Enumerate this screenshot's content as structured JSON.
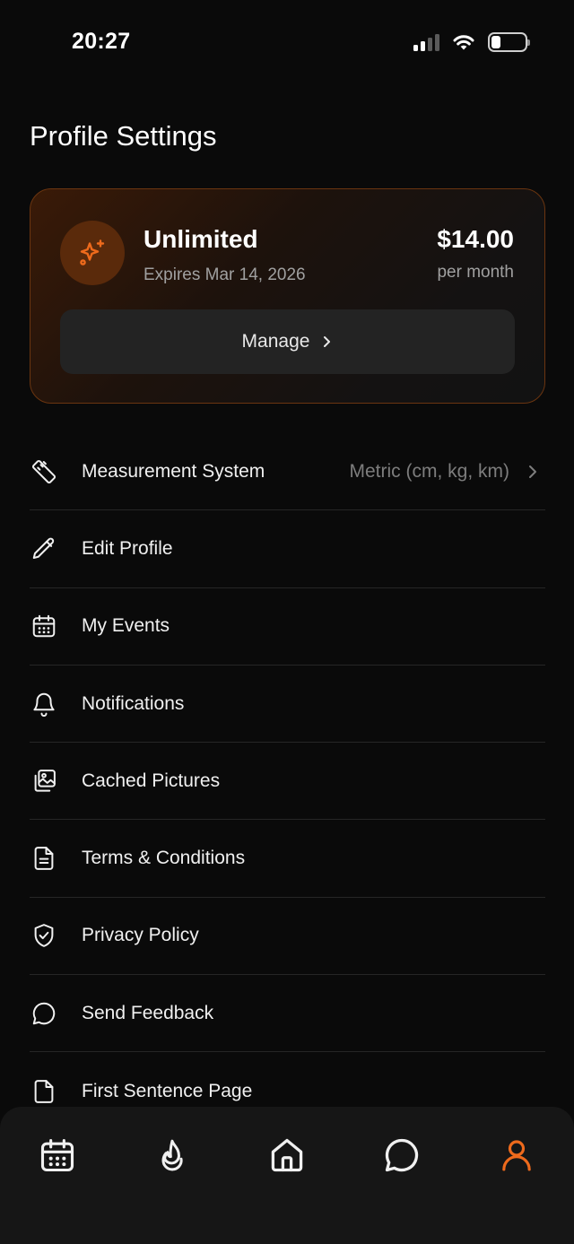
{
  "status_bar": {
    "time": "20:27"
  },
  "page": {
    "title": "Profile Settings"
  },
  "subscription": {
    "plan_name": "Unlimited",
    "expiry": "Expires Mar 14, 2026",
    "price": "$14.00",
    "period": "per month",
    "manage_label": "Manage",
    "icon": "sparkles-icon"
  },
  "settings": [
    {
      "label": "Measurement System",
      "value": "Metric (cm, kg, km)",
      "icon": "ruler-icon"
    },
    {
      "label": "Edit Profile",
      "icon": "pencil-icon"
    },
    {
      "label": "My Events",
      "icon": "calendar-icon"
    },
    {
      "label": "Notifications",
      "icon": "bell-icon"
    },
    {
      "label": "Cached Pictures",
      "icon": "images-icon"
    },
    {
      "label": "Terms & Conditions",
      "icon": "document-icon"
    },
    {
      "label": "Privacy Policy",
      "icon": "shield-check-icon"
    },
    {
      "label": "Send Feedback",
      "icon": "chat-bubble-icon"
    },
    {
      "label": "First Sentence Page",
      "icon": "file-icon"
    }
  ],
  "tab_bar": {
    "tabs": [
      {
        "icon": "calendar-icon",
        "active": false
      },
      {
        "icon": "flame-icon",
        "active": false
      },
      {
        "icon": "home-icon",
        "active": false
      },
      {
        "icon": "chat-bubble-icon",
        "active": false
      },
      {
        "icon": "user-icon",
        "active": true
      }
    ]
  },
  "colors": {
    "accent": "#ee6a1c",
    "background": "#0a0a0a",
    "muted_text": "#7d7d7d"
  }
}
